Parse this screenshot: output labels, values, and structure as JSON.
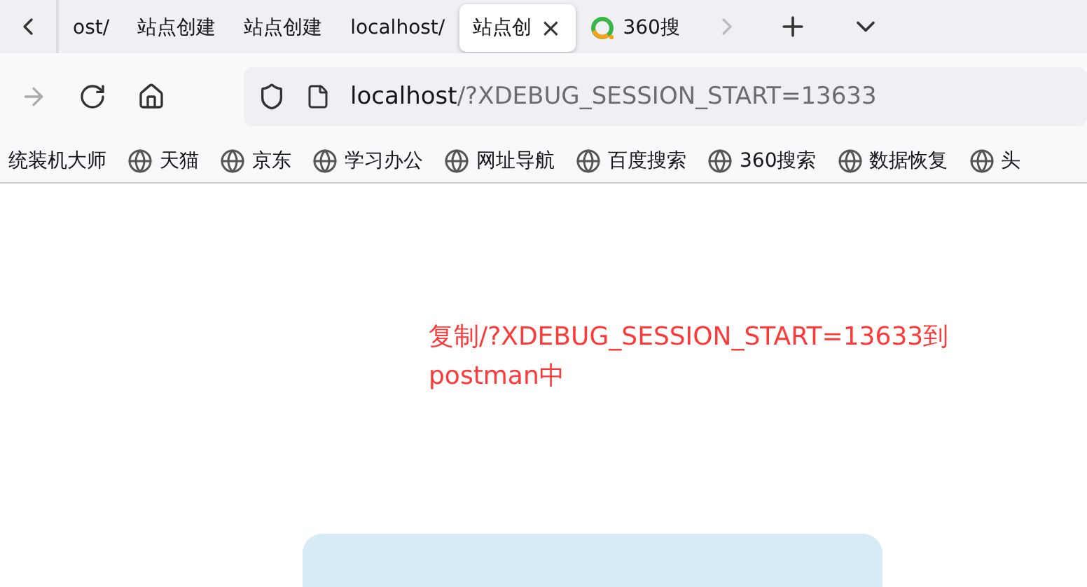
{
  "tabs": [
    {
      "label": "ost/",
      "selected": false,
      "kind": "page"
    },
    {
      "label": "站点创建",
      "selected": false,
      "kind": "page"
    },
    {
      "label": "站点创建",
      "selected": false,
      "kind": "page"
    },
    {
      "label": "localhost/",
      "selected": false,
      "kind": "page"
    },
    {
      "label": "站点创",
      "selected": true,
      "kind": "page",
      "close": "×"
    },
    {
      "label": "360搜",
      "selected": false,
      "kind": "search"
    }
  ],
  "address": {
    "host": "localhost",
    "path": "/?XDEBUG_SESSION_START=13633"
  },
  "bookmarks": [
    "统装机大师",
    "天猫",
    "京东",
    "学习办公",
    "网址导航",
    "百度搜索",
    "360搜索",
    "数据恢复",
    "头"
  ],
  "note": "复制/?XDEBUG_SESSION_START=13633到postman中"
}
